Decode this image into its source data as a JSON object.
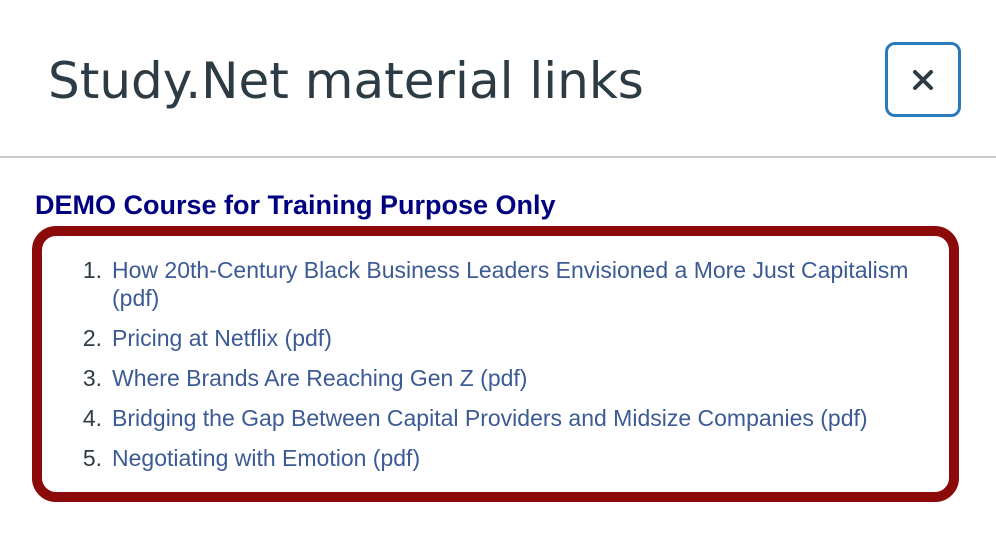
{
  "dialog": {
    "title": "Study.Net material links",
    "close_label": "×"
  },
  "course": {
    "heading": "DEMO Course for Training Purpose Only"
  },
  "materials": [
    {
      "number": "1.",
      "label": "How 20th-Century Black Business Leaders Envisioned a More Just Capitalism (pdf)"
    },
    {
      "number": "2.",
      "label": "Pricing at Netflix (pdf)"
    },
    {
      "number": "3.",
      "label": "Where Brands Are Reaching Gen Z (pdf)"
    },
    {
      "number": "4.",
      "label": "Bridging the Gap Between Capital Providers and Midsize Companies (pdf)"
    },
    {
      "number": "5.",
      "label": "Negotiating with Emotion (pdf)"
    }
  ],
  "colors": {
    "title_text": "#2d3b45",
    "close_border": "#2b7abc",
    "course_heading": "#000080",
    "list_border": "#8c0a0a",
    "link_text": "#3c5a94"
  },
  "icons": {
    "close": "close-icon"
  }
}
